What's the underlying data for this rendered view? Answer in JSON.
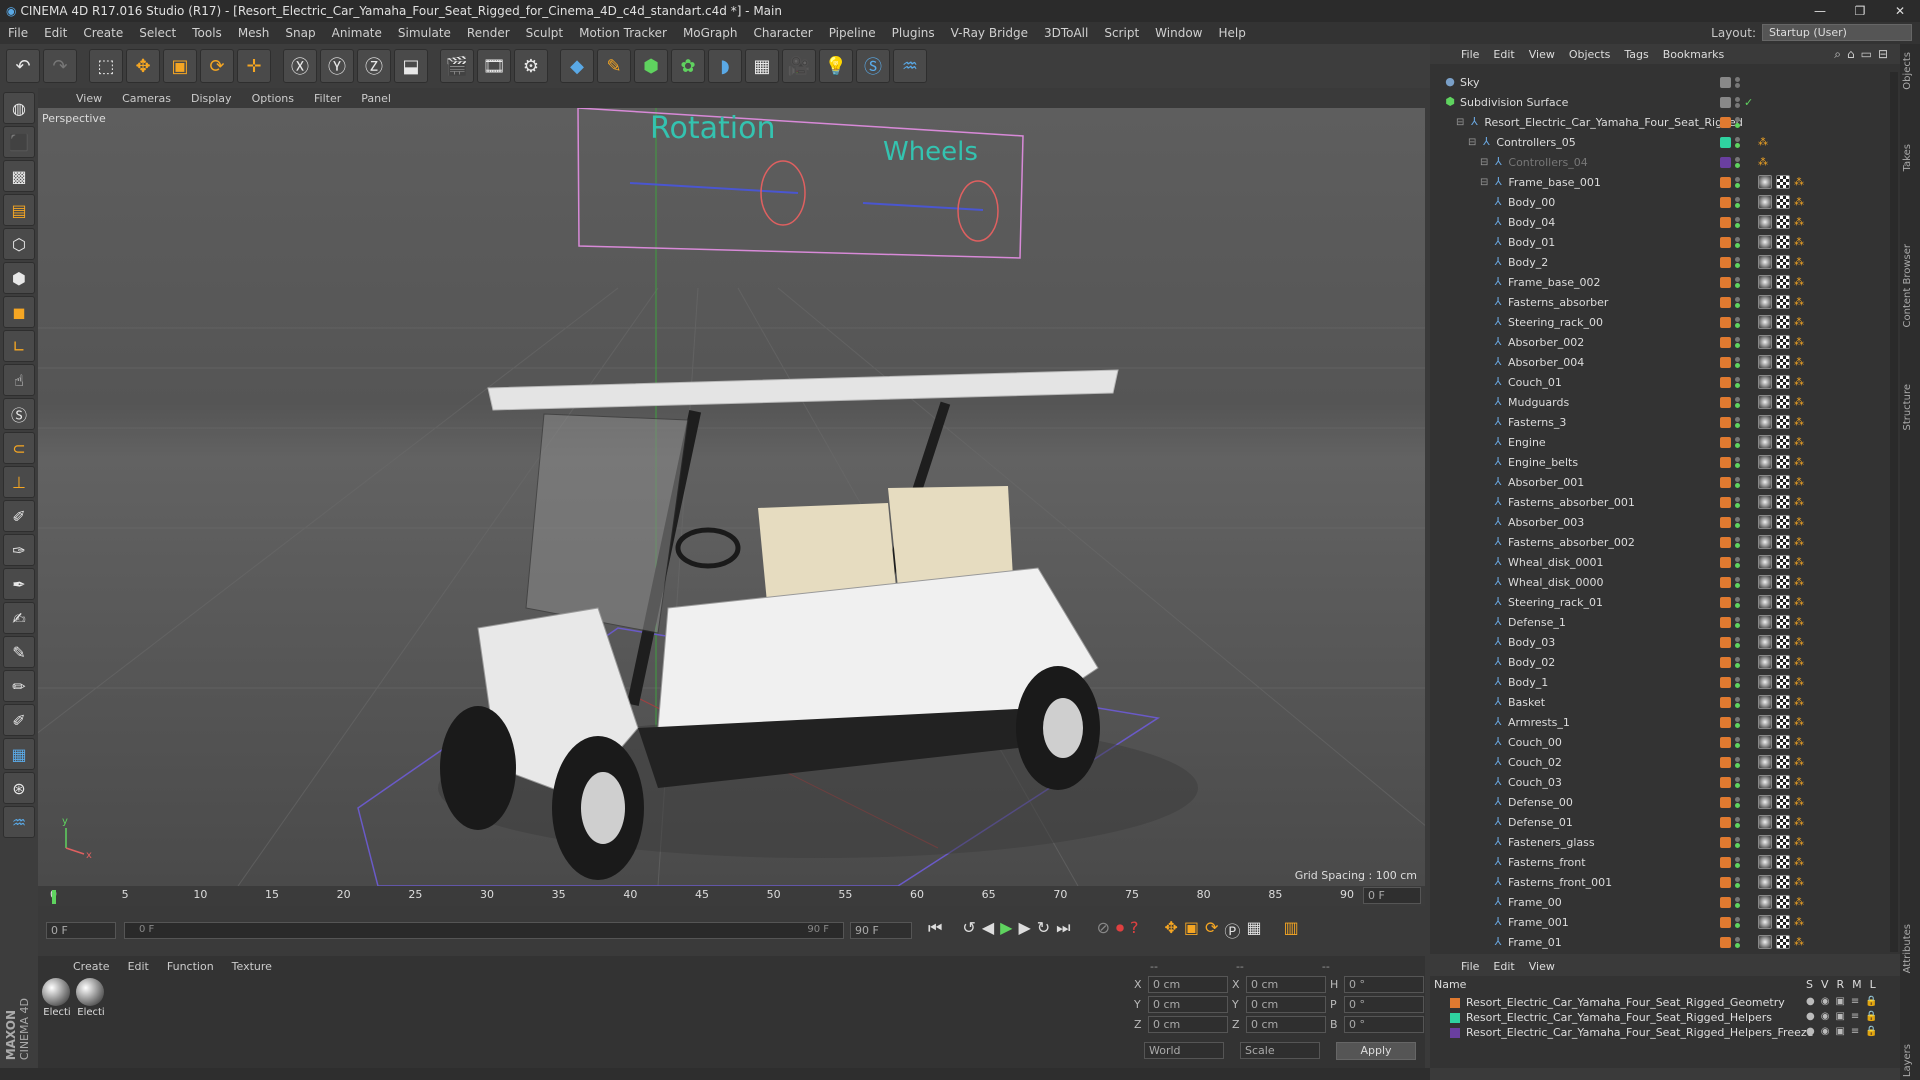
{
  "titlebar": {
    "title": "CINEMA 4D R17.016 Studio (R17) - [Resort_Electric_Car_Yamaha_Four_Seat_Rigged_for_Cinema_4D_c4d_standart.c4d *] - Main"
  },
  "menu": [
    "File",
    "Edit",
    "Create",
    "Select",
    "Tools",
    "Mesh",
    "Snap",
    "Animate",
    "Simulate",
    "Render",
    "Sculpt",
    "Motion Tracker",
    "MoGraph",
    "Character",
    "Pipeline",
    "Plugins",
    "V-Ray Bridge",
    "3DToAll",
    "Script",
    "Window",
    "Help"
  ],
  "layout": {
    "label": "Layout:",
    "value": "Startup (User)"
  },
  "viewport": {
    "menu": [
      "View",
      "Cameras",
      "Display",
      "Options",
      "Filter",
      "Panel"
    ],
    "label": "Perspective",
    "grid_spacing": "Grid Spacing : 100 cm",
    "controller_text_1": "Rotation",
    "controller_text_2": "Wheels",
    "axis_y": "y",
    "axis_x": "x"
  },
  "timeline": {
    "ticks": [
      "0",
      "5",
      "10",
      "15",
      "20",
      "25",
      "30",
      "35",
      "40",
      "45",
      "50",
      "55",
      "60",
      "65",
      "70",
      "75",
      "80",
      "85",
      "90"
    ],
    "frame_readout": "0 F"
  },
  "scrub": {
    "start": "0 F",
    "slider_start": "0 F",
    "slider_end": "90 F",
    "end": "90 F"
  },
  "material": {
    "menu": [
      "Create",
      "Edit",
      "Function",
      "Texture"
    ],
    "items": [
      "Electi",
      "Electi"
    ]
  },
  "coords": {
    "header": [
      "--",
      "--",
      "--"
    ],
    "rows": [
      {
        "a": "X",
        "v1": "0 cm",
        "b": "X",
        "v2": "0 cm",
        "c": "H",
        "v3": "0 °"
      },
      {
        "a": "Y",
        "v1": "0 cm",
        "b": "Y",
        "v2": "0 cm",
        "c": "P",
        "v3": "0 °"
      },
      {
        "a": "Z",
        "v1": "0 cm",
        "b": "Z",
        "v2": "0 cm",
        "c": "B",
        "v3": "0 °"
      }
    ],
    "mode": "World",
    "scale": "Scale",
    "apply": "Apply"
  },
  "objects": {
    "menu": [
      "File",
      "Edit",
      "View",
      "Objects",
      "Tags",
      "Bookmarks"
    ],
    "items": [
      {
        "name": "Sky",
        "level": 0,
        "color": "#888888"
      },
      {
        "name": "Subdivision Surface",
        "level": 0,
        "color": "#888888"
      },
      {
        "name": "Resort_Electric_Car_Yamaha_Four_Seat_Rigged",
        "level": 1,
        "color": "#e07a30"
      },
      {
        "name": "Controllers_05",
        "level": 2,
        "color": "#2fd3a0"
      },
      {
        "name": "Controllers_04",
        "level": 3,
        "color": "#6a3fa0"
      },
      {
        "name": "Frame_base_001",
        "level": 3,
        "color": "#e07a30"
      },
      {
        "name": "Body_00",
        "level": 4,
        "color": "#e07a30"
      },
      {
        "name": "Body_04",
        "level": 4,
        "color": "#e07a30"
      },
      {
        "name": "Body_01",
        "level": 4,
        "color": "#e07a30"
      },
      {
        "name": "Body_2",
        "level": 4,
        "color": "#e07a30"
      },
      {
        "name": "Frame_base_002",
        "level": 4,
        "color": "#e07a30"
      },
      {
        "name": "Fasterns_absorber",
        "level": 4,
        "color": "#e07a30"
      },
      {
        "name": "Steering_rack_00",
        "level": 4,
        "color": "#e07a30"
      },
      {
        "name": "Absorber_002",
        "level": 4,
        "color": "#e07a30"
      },
      {
        "name": "Absorber_004",
        "level": 4,
        "color": "#e07a30"
      },
      {
        "name": "Couch_01",
        "level": 4,
        "color": "#e07a30"
      },
      {
        "name": "Mudguards",
        "level": 4,
        "color": "#e07a30"
      },
      {
        "name": "Fasterns_3",
        "level": 4,
        "color": "#e07a30"
      },
      {
        "name": "Engine",
        "level": 4,
        "color": "#e07a30"
      },
      {
        "name": "Engine_belts",
        "level": 4,
        "color": "#e07a30"
      },
      {
        "name": "Absorber_001",
        "level": 4,
        "color": "#e07a30"
      },
      {
        "name": "Fasterns_absorber_001",
        "level": 4,
        "color": "#e07a30"
      },
      {
        "name": "Absorber_003",
        "level": 4,
        "color": "#e07a30"
      },
      {
        "name": "Fasterns_absorber_002",
        "level": 4,
        "color": "#e07a30"
      },
      {
        "name": "Wheal_disk_0001",
        "level": 4,
        "color": "#e07a30"
      },
      {
        "name": "Wheal_disk_0000",
        "level": 4,
        "color": "#e07a30"
      },
      {
        "name": "Steering_rack_01",
        "level": 4,
        "color": "#e07a30"
      },
      {
        "name": "Defense_1",
        "level": 4,
        "color": "#e07a30"
      },
      {
        "name": "Body_03",
        "level": 4,
        "color": "#e07a30"
      },
      {
        "name": "Body_02",
        "level": 4,
        "color": "#e07a30"
      },
      {
        "name": "Body_1",
        "level": 4,
        "color": "#e07a30"
      },
      {
        "name": "Basket",
        "level": 4,
        "color": "#e07a30"
      },
      {
        "name": "Armrests_1",
        "level": 4,
        "color": "#e07a30"
      },
      {
        "name": "Couch_00",
        "level": 4,
        "color": "#e07a30"
      },
      {
        "name": "Couch_02",
        "level": 4,
        "color": "#e07a30"
      },
      {
        "name": "Couch_03",
        "level": 4,
        "color": "#e07a30"
      },
      {
        "name": "Defense_00",
        "level": 4,
        "color": "#e07a30"
      },
      {
        "name": "Defense_01",
        "level": 4,
        "color": "#e07a30"
      },
      {
        "name": "Fasteners_glass",
        "level": 4,
        "color": "#e07a30"
      },
      {
        "name": "Fasterns_front",
        "level": 4,
        "color": "#e07a30"
      },
      {
        "name": "Fasterns_front_001",
        "level": 4,
        "color": "#e07a30"
      },
      {
        "name": "Frame_00",
        "level": 4,
        "color": "#e07a30"
      },
      {
        "name": "Frame_001",
        "level": 4,
        "color": "#e07a30"
      },
      {
        "name": "Frame_01",
        "level": 4,
        "color": "#e07a30"
      }
    ]
  },
  "layers": {
    "menu": [
      "File",
      "Edit",
      "View"
    ],
    "header_name": "Name",
    "cols": [
      "S",
      "V",
      "R",
      "M",
      "L"
    ],
    "items": [
      {
        "name": "Resort_Electric_Car_Yamaha_Four_Seat_Rigged_Geometry",
        "color": "#e07a30"
      },
      {
        "name": "Resort_Electric_Car_Yamaha_Four_Seat_Rigged_Helpers",
        "color": "#2fd3a0"
      },
      {
        "name": "Resort_Electric_Car_Yamaha_Four_Seat_Rigged_Helpers_Freeze",
        "color": "#6a3fa0"
      }
    ]
  },
  "side_tabs": [
    "Objects",
    "Takes",
    "Content Browser",
    "Structure",
    "Attributes",
    "Layers"
  ],
  "maxon": {
    "line1": "MAXON",
    "line2": "CINEMA 4D"
  }
}
